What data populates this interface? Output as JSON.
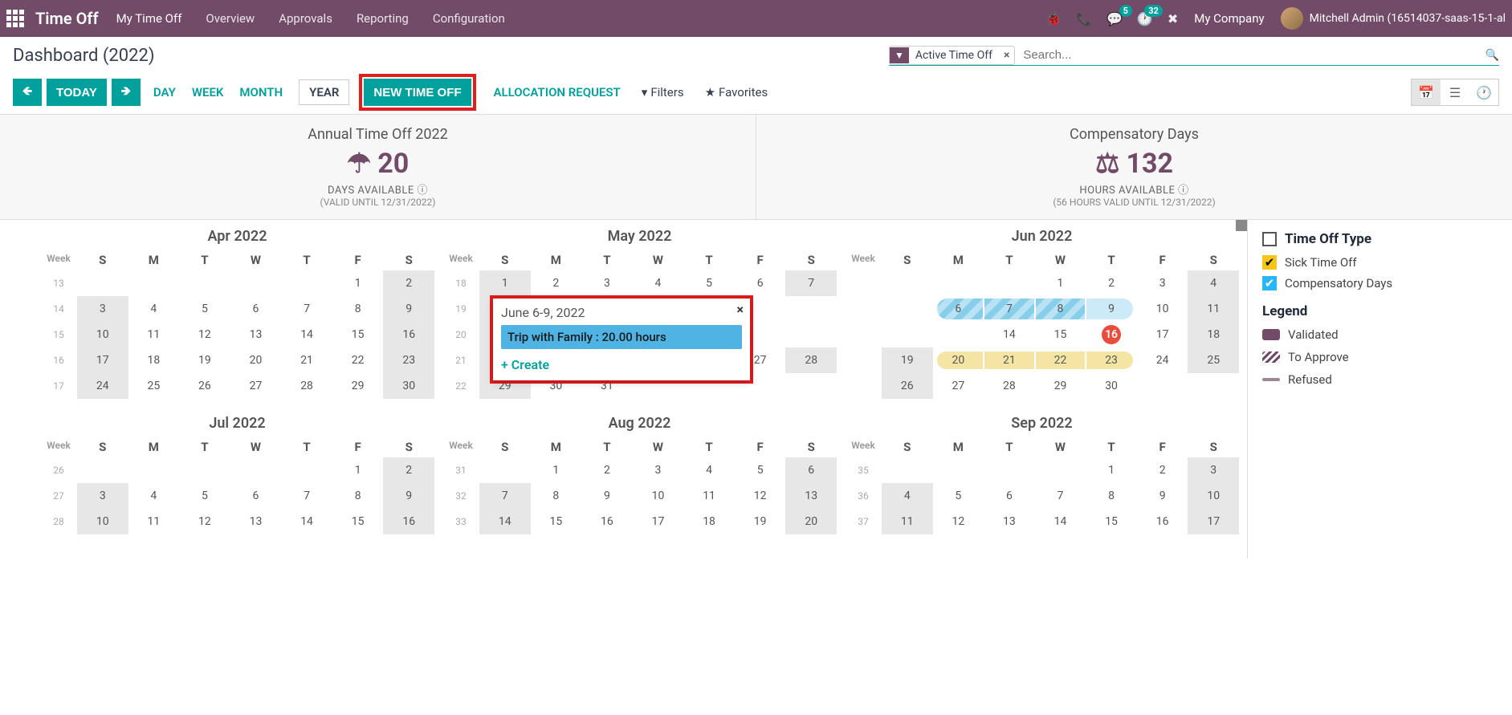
{
  "nav": {
    "brand": "Time Off",
    "links": [
      "My Time Off",
      "Overview",
      "Approvals",
      "Reporting",
      "Configuration"
    ],
    "badge_messages": "5",
    "badge_activities": "32",
    "company": "My Company",
    "user": "Mitchell Admin (16514037-saas-15-1-al"
  },
  "cp": {
    "title": "Dashboard (2022)",
    "filter_chip": "Active Time Off",
    "search_placeholder": "Search...",
    "today": "TODAY",
    "views": {
      "day": "DAY",
      "week": "WEEK",
      "month": "MONTH",
      "year": "YEAR"
    },
    "new_timeoff": "NEW TIME OFF",
    "alloc_request": "ALLOCATION REQUEST",
    "filters": "Filters",
    "favorites": "Favorites"
  },
  "summary": [
    {
      "title": "Annual Time Off 2022",
      "value": "20",
      "label": "DAYS AVAILABLE",
      "sub": "(VALID UNTIL 12/31/2022)",
      "icon": "umbrella"
    },
    {
      "title": "Compensatory Days",
      "value": "132",
      "label": "HOURS AVAILABLE",
      "sub": "(56 HOURS VALID UNTIL 12/31/2022)",
      "icon": "balance"
    }
  ],
  "weekdays": [
    "S",
    "M",
    "T",
    "W",
    "T",
    "F",
    "S"
  ],
  "week_label": "Week",
  "months_row1": [
    {
      "title": "Apr 2022",
      "weeks": [
        {
          "wk": "13",
          "days": [
            "",
            "",
            "",
            "",
            "",
            "1",
            "w2"
          ]
        },
        {
          "wk": "14",
          "days": [
            "w3",
            "4",
            "5",
            "6",
            "7",
            "8",
            "w9"
          ]
        },
        {
          "wk": "15",
          "days": [
            "w10",
            "11",
            "12",
            "13",
            "14",
            "15",
            "w16"
          ]
        },
        {
          "wk": "16",
          "days": [
            "w17",
            "18",
            "19",
            "20",
            "21",
            "22",
            "w23"
          ]
        },
        {
          "wk": "17",
          "days": [
            "w24",
            "25",
            "26",
            "27",
            "28",
            "29",
            "w30"
          ]
        }
      ]
    },
    {
      "title": "May 2022",
      "weeks": [
        {
          "wk": "18",
          "days": [
            "w1",
            "2",
            "3",
            "4",
            "5",
            "6",
            "w7"
          ]
        },
        {
          "wk": "19",
          "days": [
            "w8",
            "9",
            "10",
            "",
            "",
            "",
            ""
          ]
        },
        {
          "wk": "20",
          "days": [
            "w15",
            "16",
            "17",
            "",
            "",
            "",
            ""
          ]
        },
        {
          "wk": "21",
          "days": [
            "w22",
            "23",
            "24",
            "",
            "",
            "27",
            "w28"
          ]
        },
        {
          "wk": "22",
          "days": [
            "w29",
            "30",
            "31",
            "",
            "",
            "",
            ""
          ]
        }
      ]
    },
    {
      "title": "Jun 2022",
      "weeks": [
        {
          "wk": "",
          "days": [
            "",
            "",
            "",
            "1",
            "2",
            "3",
            "w4"
          ]
        },
        {
          "wk": "",
          "days": [
            "",
            "c6",
            "c7",
            "c8",
            "ce9",
            "10",
            "w11"
          ]
        },
        {
          "wk": "",
          "days": [
            "",
            "",
            "14",
            "15",
            "t16",
            "17",
            "w18"
          ]
        },
        {
          "wk": "",
          "days": [
            "s19",
            "v20",
            "v21",
            "v22",
            "ve23",
            "24",
            "w25"
          ]
        },
        {
          "wk": "",
          "days": [
            "w26",
            "27",
            "28",
            "29",
            "30",
            "",
            ""
          ]
        }
      ]
    }
  ],
  "months_row2": [
    {
      "title": "Jul 2022",
      "weeks": [
        {
          "wk": "26",
          "days": [
            "",
            "",
            "",
            "",
            "",
            "1",
            "w2"
          ]
        },
        {
          "wk": "27",
          "days": [
            "w3",
            "4",
            "5",
            "6",
            "7",
            "8",
            "w9"
          ]
        },
        {
          "wk": "28",
          "days": [
            "w10",
            "11",
            "12",
            "13",
            "14",
            "15",
            "w16"
          ]
        }
      ]
    },
    {
      "title": "Aug 2022",
      "weeks": [
        {
          "wk": "31",
          "days": [
            "",
            "1",
            "2",
            "3",
            "4",
            "5",
            "w6"
          ]
        },
        {
          "wk": "32",
          "days": [
            "w7",
            "8",
            "9",
            "10",
            "11",
            "12",
            "w13"
          ]
        },
        {
          "wk": "33",
          "days": [
            "w14",
            "15",
            "16",
            "17",
            "18",
            "19",
            "w20"
          ]
        }
      ]
    },
    {
      "title": "Sep 2022",
      "weeks": [
        {
          "wk": "35",
          "days": [
            "",
            "",
            "",
            "",
            "1",
            "2",
            "w3"
          ]
        },
        {
          "wk": "36",
          "days": [
            "w4",
            "5",
            "6",
            "7",
            "8",
            "9",
            "w10"
          ]
        },
        {
          "wk": "37",
          "days": [
            "w11",
            "12",
            "13",
            "14",
            "15",
            "16",
            "w17"
          ]
        }
      ]
    }
  ],
  "popover": {
    "title": "June 6-9, 2022",
    "event": "Trip with Family : 20.00 hours",
    "create": "Create"
  },
  "sidebar": {
    "head": "Time Off Type",
    "types": [
      "Sick Time Off",
      "Compensatory Days"
    ],
    "legend_title": "Legend",
    "legend": [
      {
        "label": "Validated",
        "color": "#714B67"
      },
      {
        "label": "To Approve",
        "stripe": true
      },
      {
        "label": "Refused",
        "color": "#9c8893"
      }
    ]
  }
}
